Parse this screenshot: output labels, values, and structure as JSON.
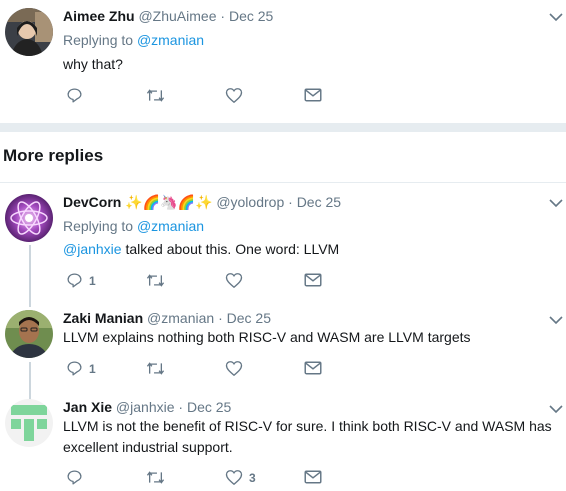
{
  "colors": {
    "link": "#1b95e0",
    "muted": "#657786",
    "text": "#14171a",
    "border": "#e6ecf0",
    "thread": "#ccd6dd"
  },
  "tweets": [
    {
      "name": "Aimee Zhu",
      "handle": "@ZhuAimee",
      "separator": "·",
      "time": "Dec 25",
      "replying_prefix": "Replying to",
      "replying_to": "@zmanian",
      "text": "why that?",
      "counts": {
        "reply": "",
        "retweet": "",
        "like": ""
      }
    },
    {
      "name": "DevCorn",
      "emoji": "✨🌈🦄🌈✨",
      "handle": "@yolodrop",
      "separator": "·",
      "time": "Dec 25",
      "replying_prefix": "Replying to",
      "replying_to": "@zmanian",
      "mention": "@janhxie",
      "text": " talked about this. One word: LLVM",
      "counts": {
        "reply": "1",
        "retweet": "",
        "like": ""
      }
    },
    {
      "name": "Zaki Manian",
      "handle": "@zmanian",
      "separator": "·",
      "time": "Dec 25",
      "text": "LLVM explains nothing both RISC-V and WASM are LLVM targets",
      "counts": {
        "reply": "1",
        "retweet": "",
        "like": ""
      }
    },
    {
      "name": "Jan Xie",
      "handle": "@janhxie",
      "separator": "·",
      "time": "Dec 25",
      "text": "LLVM is not the benefit of RISC-V for sure. I think both RISC-V and WASM has excellent industrial support.",
      "counts": {
        "reply": "",
        "retweet": "",
        "like": "3"
      }
    }
  ],
  "section": {
    "title": "More replies"
  },
  "icons": [
    "reply-icon",
    "retweet-icon",
    "like-icon",
    "message-icon",
    "chevron-down-icon"
  ]
}
